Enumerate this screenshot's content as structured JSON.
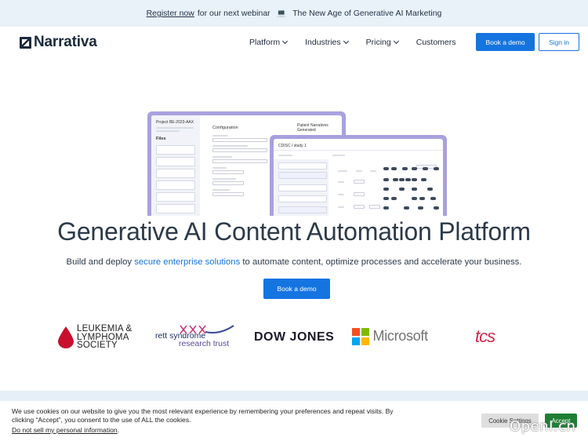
{
  "announcement": {
    "link_text": "Register now",
    "text": "for our next webinar",
    "laptop_glyph": "💻",
    "webinar_title": "The New Age of Generative AI Marketing"
  },
  "header": {
    "logo_text": "Narrativa",
    "nav": [
      {
        "label": "Platform",
        "dropdown": true
      },
      {
        "label": "Industries",
        "dropdown": true
      },
      {
        "label": "Pricing",
        "dropdown": true
      },
      {
        "label": "Customers",
        "dropdown": false
      }
    ],
    "book_demo": "Book a demo",
    "sign_in": "Sign in"
  },
  "mockup": {
    "project": "Project BE-2023-AAX",
    "files_label": "Files",
    "configuration": "Configuration",
    "patient_narratives": "Patient Narratives Generated",
    "study": "CDISC / study 1"
  },
  "hero": {
    "title": "Generative AI Content Automation Platform",
    "subtitle_before": "Build and deploy",
    "subtitle_link": "secure enterprise solutions",
    "subtitle_after": "to automate content, optimize processes and accelerate your business.",
    "cta": "Book a demo"
  },
  "logos": {
    "lls": [
      "LEUKEMIA &",
      "LYMPHOMA",
      "SOCIETY"
    ],
    "rett": [
      "rett syndrome",
      "research trust"
    ],
    "dow_jones": "DOW JONES",
    "microsoft": "Microsoft",
    "tcs": "tcs"
  },
  "cookie": {
    "message": "We use cookies on our website to give you the most relevant experience by remembering your preferences and repeat visits. By clicking “Accept”, you consent to the use of ALL the cookies.",
    "do_not_sell": "Do not sell my personal information",
    "period": ".",
    "settings": "Cookie Settings",
    "accept": "Accept"
  },
  "watermark": "OpenI.cn",
  "colors": {
    "accent": "#1474e0",
    "announce_bg": "#e9f1f9",
    "mockup_frame": "#a8a1de",
    "accept_green": "#1e7e34",
    "tcs_red": "#d0274a"
  }
}
